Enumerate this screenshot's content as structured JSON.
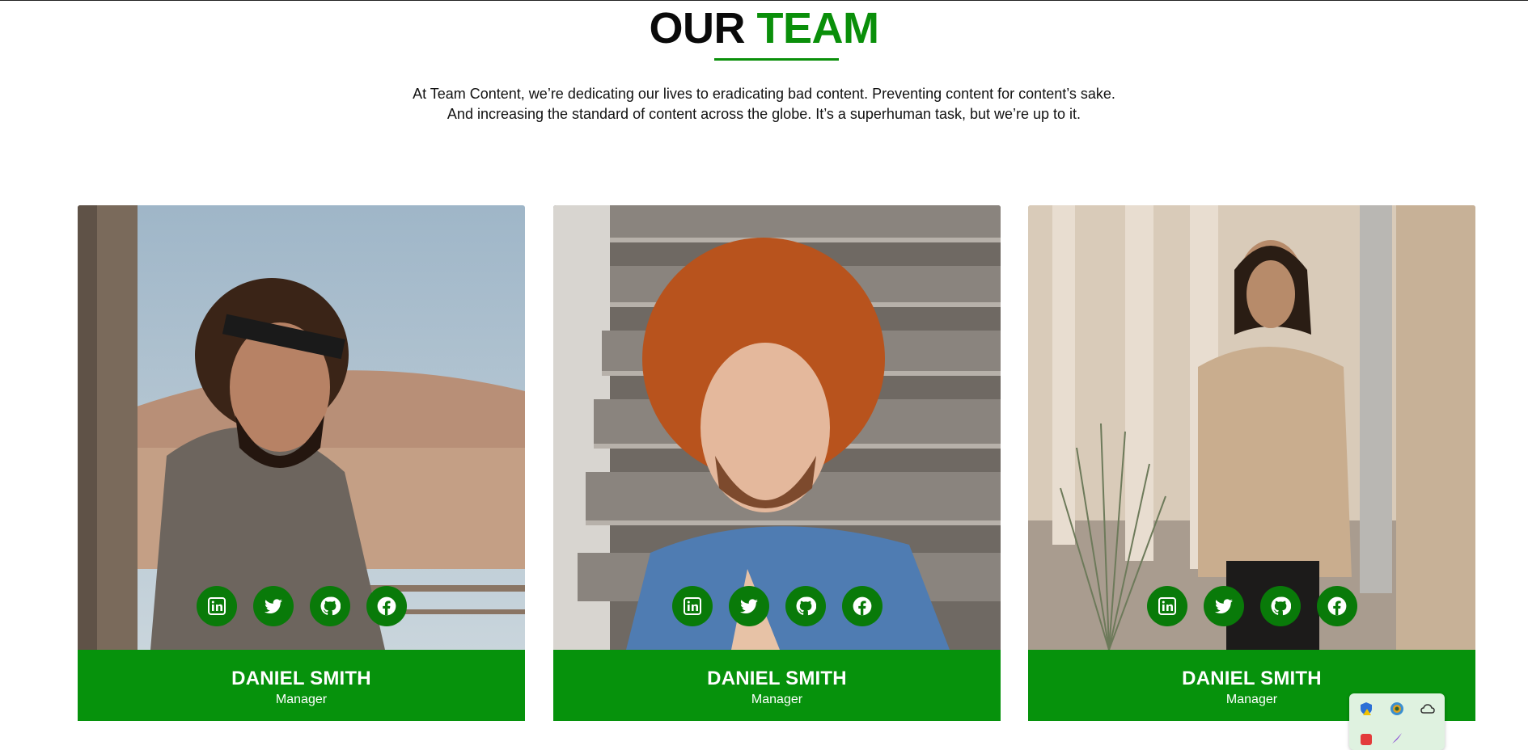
{
  "header": {
    "title_part1": "OUR",
    "title_part2": "TEAM",
    "intro_line1": "At Team Content, we’re dedicating our lives to eradicating bad content. Preventing content for content’s sake.",
    "intro_line2": "And increasing the standard of content across the globe. It’s a superhuman task, but we’re up to it."
  },
  "team": [
    {
      "name": "DANIEL SMITH",
      "role": "Manager",
      "socials": [
        "linkedin-icon",
        "twitter-icon",
        "github-icon",
        "facebook-icon"
      ]
    },
    {
      "name": "DANIEL SMITH",
      "role": "Manager",
      "socials": [
        "linkedin-icon",
        "twitter-icon",
        "github-icon",
        "facebook-icon"
      ]
    },
    {
      "name": "DANIEL SMITH",
      "role": "Manager",
      "socials": [
        "linkedin-icon",
        "twitter-icon",
        "github-icon",
        "facebook-icon"
      ]
    }
  ],
  "colors": {
    "accent": "#0a8f0a",
    "card_band": "#06920c",
    "social_bg": "#097a09"
  }
}
